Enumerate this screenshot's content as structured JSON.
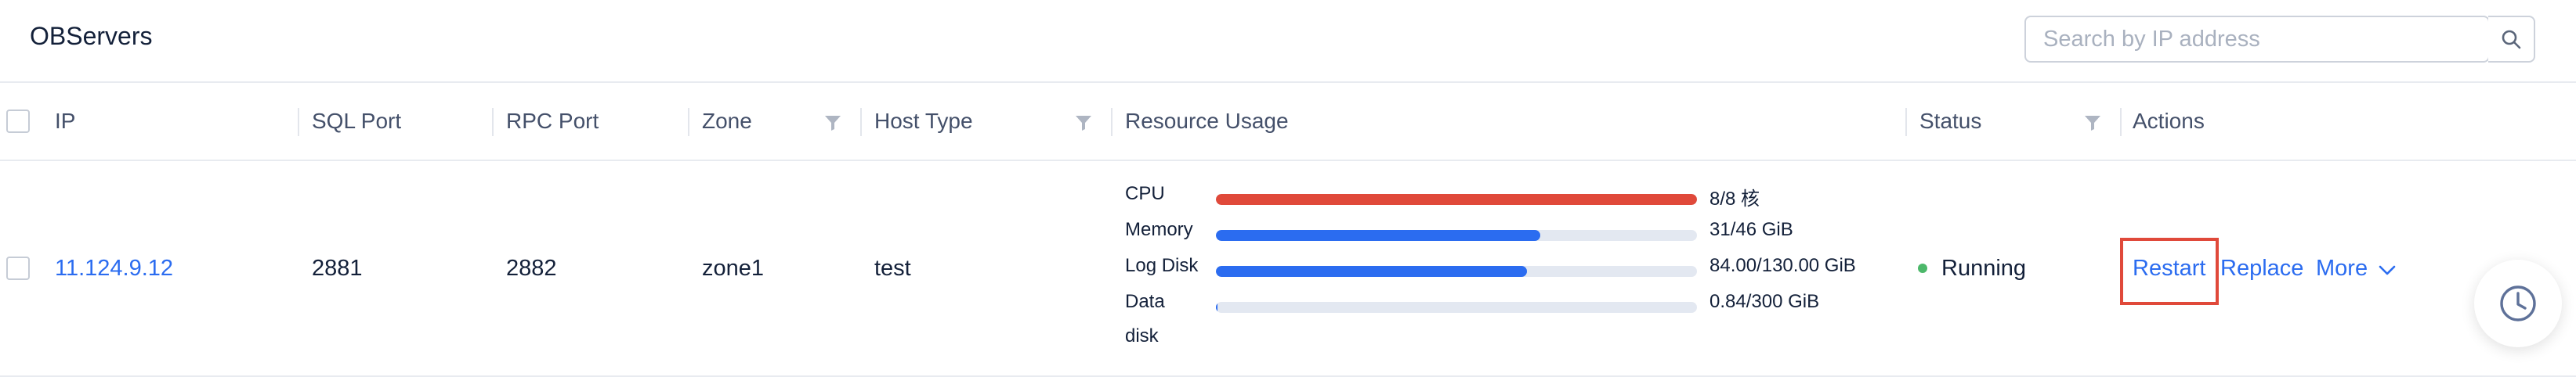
{
  "page": {
    "title": "OBServers"
  },
  "search": {
    "placeholder": "Search by IP address"
  },
  "table": {
    "columns": {
      "ip": "IP",
      "sql_port": "SQL Port",
      "rpc_port": "RPC Port",
      "zone": "Zone",
      "host_type": "Host Type",
      "resource_usage": "Resource Usage",
      "status": "Status",
      "actions": "Actions"
    },
    "rows": [
      {
        "ip": "11.124.9.12",
        "sql_port": "2881",
        "rpc_port": "2882",
        "zone": "zone1",
        "host_type": "test",
        "resources": [
          {
            "label": "CPU",
            "value": "8/8 核",
            "fraction": 1.0,
            "color": "#e0493a"
          },
          {
            "label": "Memory",
            "value": "31/46 GiB",
            "fraction": 0.674,
            "color": "#2b6cf0"
          },
          {
            "label": "Log Disk",
            "value": "84.00/130.00 GiB",
            "fraction": 0.646,
            "color": "#2b6cf0"
          },
          {
            "label": "Data",
            "label_line2": "disk",
            "value": "0.84/300 GiB",
            "fraction": 0.003,
            "color": "#2b6cf0"
          }
        ],
        "status": "Running",
        "status_color": "#4cb86a",
        "actions": {
          "restart": "Restart",
          "replace": "Replace",
          "more": "More"
        }
      }
    ]
  },
  "icons": {
    "search": "search-icon",
    "filter": "filter-icon",
    "chevron": "chevron-down-icon",
    "history": "clock-icon"
  }
}
